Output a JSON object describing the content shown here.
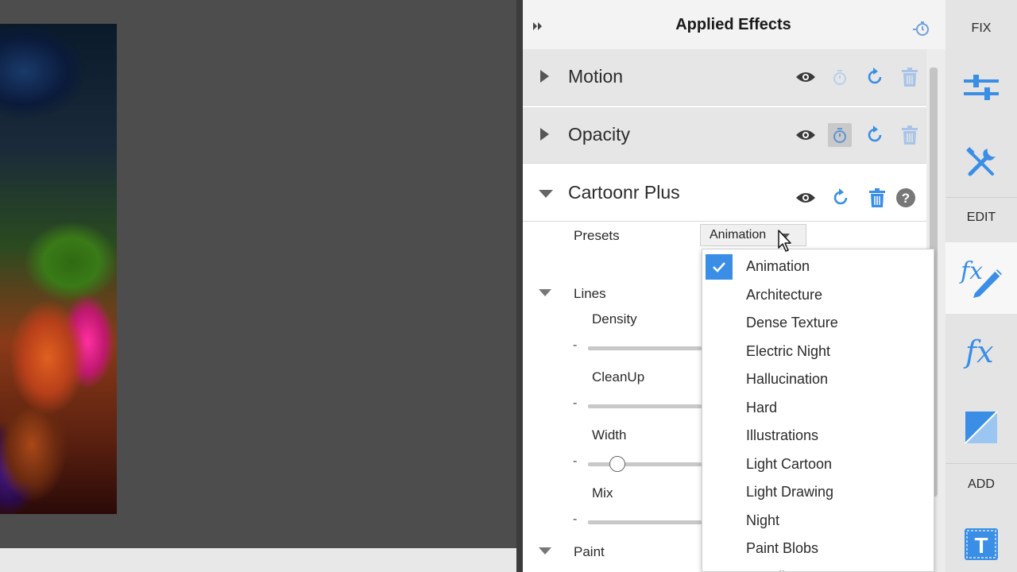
{
  "panel": {
    "title": "Applied Effects"
  },
  "effects": [
    {
      "label": "Motion"
    },
    {
      "label": "Opacity"
    },
    {
      "label": "Cartoonr Plus"
    }
  ],
  "cartoonr": {
    "presets_label": "Presets",
    "presets_value": "Animation",
    "lines_label": "Lines",
    "density_label": "Density",
    "cleanup_label": "CleanUp",
    "width_label": "Width",
    "mix_label": "Mix",
    "paint_label": "Paint",
    "minus": "-",
    "width_slider_fraction": 0.26
  },
  "presets_menu": {
    "items": [
      {
        "label": "Animation",
        "checked": true
      },
      {
        "label": "Architecture"
      },
      {
        "label": "Dense Texture"
      },
      {
        "label": "Electric Night"
      },
      {
        "label": "Hallucination"
      },
      {
        "label": "Hard"
      },
      {
        "label": "Illustrations"
      },
      {
        "label": "Light Cartoon"
      },
      {
        "label": "Light Drawing"
      },
      {
        "label": "Night"
      },
      {
        "label": "Paint Blobs"
      },
      {
        "label": "Pencil Texture"
      }
    ]
  },
  "toolbar": {
    "fix_label": "FIX",
    "edit_label": "EDIT",
    "add_label": "ADD"
  },
  "colors": {
    "accent_blue": "#3a8ee6",
    "panel_bg": "#ffffff",
    "toolbar_bg": "#e4e4e4"
  }
}
